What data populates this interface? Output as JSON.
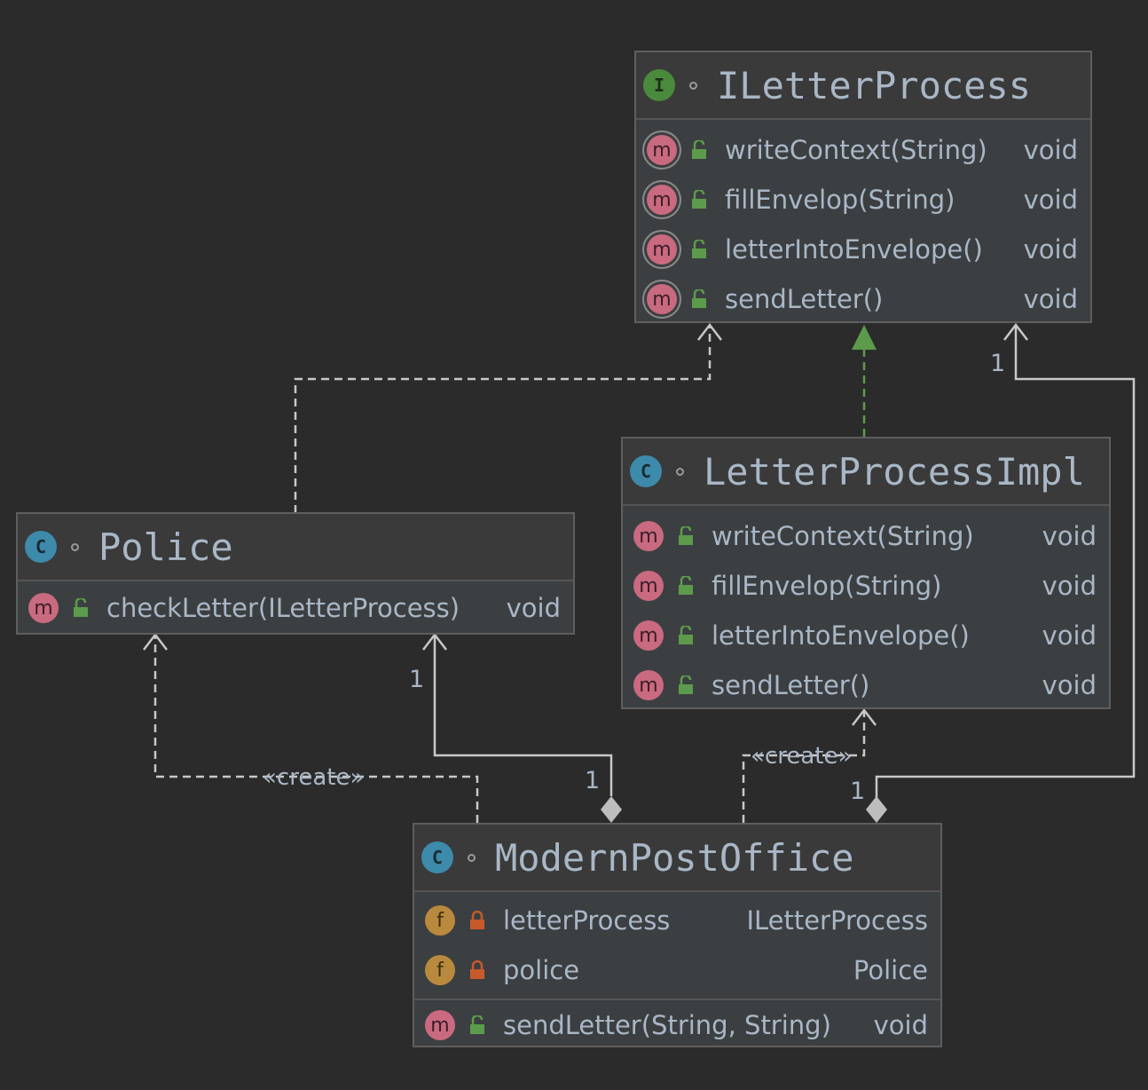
{
  "nodes": {
    "iletterprocess": {
      "kind": "I",
      "title": "ILetterProcess",
      "methods": [
        {
          "badge": "m",
          "name": "writeContext(String)",
          "type": "void"
        },
        {
          "badge": "m",
          "name": "fillEnvelop(String)",
          "type": "void"
        },
        {
          "badge": "m",
          "name": "letterIntoEnvelope()",
          "type": "void"
        },
        {
          "badge": "m",
          "name": "sendLetter()",
          "type": "void"
        }
      ]
    },
    "letterprocessimpl": {
      "kind": "C",
      "title": "LetterProcessImpl",
      "methods": [
        {
          "badge": "m",
          "name": "writeContext(String)",
          "type": "void"
        },
        {
          "badge": "m",
          "name": "fillEnvelop(String)",
          "type": "void"
        },
        {
          "badge": "m",
          "name": "letterIntoEnvelope()",
          "type": "void"
        },
        {
          "badge": "m",
          "name": "sendLetter()",
          "type": "void"
        }
      ]
    },
    "police": {
      "kind": "C",
      "title": "Police",
      "methods": [
        {
          "badge": "m",
          "name": "checkLetter(ILetterProcess)",
          "type": "void"
        }
      ]
    },
    "modernpostoffice": {
      "kind": "C",
      "title": "ModernPostOffice",
      "fields": [
        {
          "badge": "f",
          "name": "letterProcess",
          "type": "ILetterProcess"
        },
        {
          "badge": "f",
          "name": "police",
          "type": "Police"
        }
      ],
      "methods": [
        {
          "badge": "m",
          "name": "sendLetter(String, String)",
          "type": "void"
        }
      ]
    }
  },
  "edges": {
    "stereotype": "«create»",
    "multiplicity": "1"
  },
  "colors": {
    "background": "#2b2b2b",
    "node_fill": "#3c3f41",
    "edge": "#c8c8c8",
    "realization": "#5c9b4b",
    "public_lock": "#5c9b4b",
    "private_lock": "#c75a2b"
  }
}
